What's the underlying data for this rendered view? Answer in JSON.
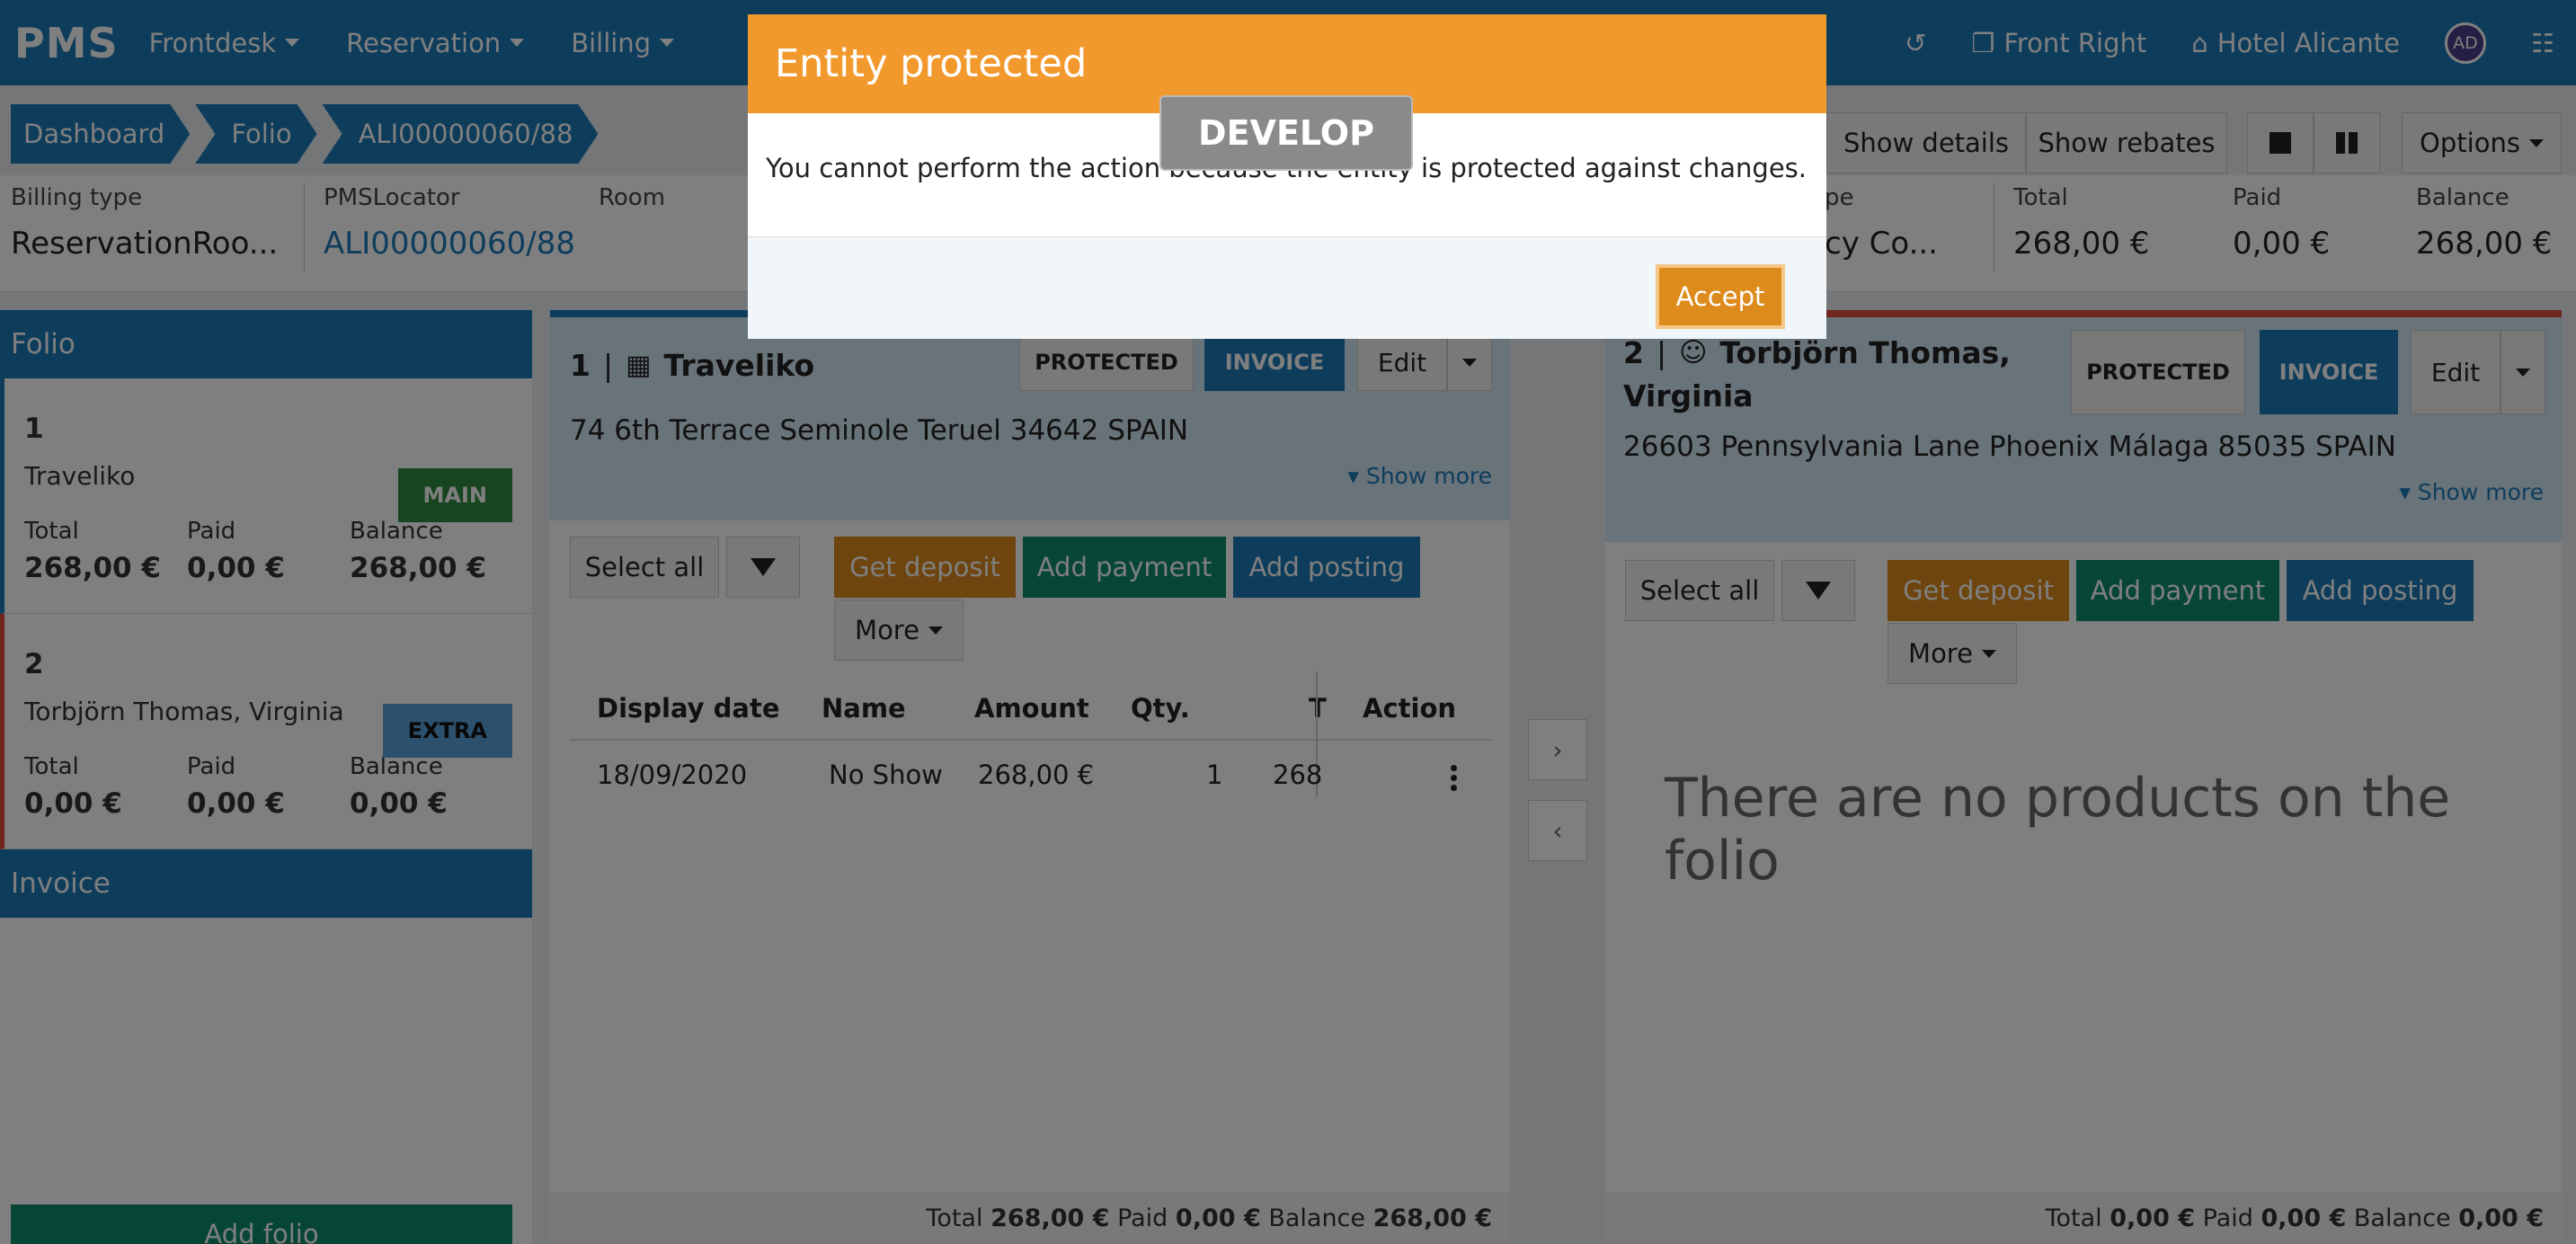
{
  "app": {
    "logo": "PMS"
  },
  "nav": {
    "items": [
      "Frontdesk",
      "Reservation",
      "Billing"
    ],
    "right": {
      "front": "Front Right",
      "hotel": "Hotel Alicante",
      "avatar": "AD"
    }
  },
  "breadcrumbs": [
    "Dashboard",
    "Folio",
    "ALI00000060/88"
  ],
  "toolbar": {
    "show_details": "Show details",
    "show_rebates": "Show rebates",
    "options": "Options"
  },
  "info": {
    "billing_type_label": "Billing type",
    "billing_type_value": "ReservationRoo...",
    "locator_label": "PMSLocator",
    "locator_value": "ALI00000060/88",
    "room_label": "Room",
    "type_label": "pe",
    "type_value": "cy Co...",
    "total_label": "Total",
    "total_value": "268,00 €",
    "paid_label": "Paid",
    "paid_value": "0,00 €",
    "balance_label": "Balance",
    "balance_value": "268,00 €"
  },
  "sidebar": {
    "folio_header": "Folio",
    "invoice_header": "Invoice",
    "add_folio": "Add folio",
    "folios": [
      {
        "num": "1",
        "name": "Traveliko",
        "badge": "MAIN",
        "total_label": "Total",
        "paid_label": "Paid",
        "balance_label": "Balance",
        "total": "268,00 €",
        "paid": "0,00 €",
        "balance": "268,00 €"
      },
      {
        "num": "2",
        "name": "Torbjörn Thomas, Virginia",
        "badge": "EXTRA",
        "total_label": "Total",
        "paid_label": "Paid",
        "balance_label": "Balance",
        "total": "0,00 €",
        "paid": "0,00 €",
        "balance": "0,00 €"
      }
    ]
  },
  "panel1": {
    "num": "1",
    "sep": "|",
    "name": "Traveliko",
    "address": "74 6th Terrace Seminole Teruel 34642 SPAIN",
    "show_more": "Show more",
    "protected": "PROTECTED",
    "invoice": "INVOICE",
    "edit": "Edit",
    "select_all": "Select all",
    "get_deposit": "Get deposit",
    "add_payment": "Add payment",
    "add_posting": "Add posting",
    "more": "More",
    "columns": [
      "Display date",
      "Name",
      "Amount",
      "Qty.",
      "T",
      "Action"
    ],
    "rows": [
      {
        "date": "18/09/2020",
        "name": "No Show",
        "amount": "268,00 €",
        "qty": "1",
        "total": "268"
      }
    ],
    "footer": {
      "total_label": "Total",
      "total": "268,00 €",
      "paid_label": "Paid",
      "paid": "0,00 €",
      "balance_label": "Balance",
      "balance": "268,00 €"
    }
  },
  "panel2": {
    "num": "2",
    "sep": "|",
    "name": "Torbjörn Thomas,",
    "name2": "Virginia",
    "address": "26603 Pennsylvania Lane Phoenix Málaga 85035 SPAIN",
    "show_more": "Show more",
    "protected": "PROTECTED",
    "invoice": "INVOICE",
    "edit": "Edit",
    "select_all": "Select all",
    "get_deposit": "Get deposit",
    "add_payment": "Add payment",
    "add_posting": "Add posting",
    "more": "More",
    "empty": "There are no products on the folio",
    "footer": {
      "total_label": "Total",
      "total": "0,00 €",
      "paid_label": "Paid",
      "paid": "0,00 €",
      "balance_label": "Balance",
      "balance": "0,00 €"
    }
  },
  "modal": {
    "title": "Entity protected",
    "message": "You cannot perform the action because the entity is protected against changes.",
    "accept": "Accept"
  },
  "env_badge": "DEVELOP",
  "colors": {
    "primary": "#1c7ab8",
    "warning": "#f2992e",
    "deposit": "#dd8b1c",
    "success": "#0e8c6d",
    "main_badge": "#2e8b3e",
    "extra_badge": "#5aa2db"
  }
}
